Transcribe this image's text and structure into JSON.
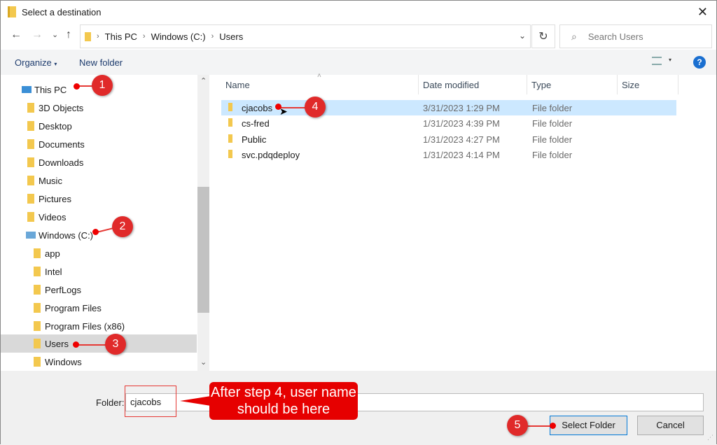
{
  "window": {
    "title": "Select a destination"
  },
  "address": {
    "crumbs": [
      "This PC",
      "Windows (C:)",
      "Users"
    ]
  },
  "search": {
    "placeholder": "Search Users"
  },
  "toolbar": {
    "organize": "Organize",
    "organize_caret": "▾",
    "new_folder": "New folder",
    "help": "?"
  },
  "nav": {
    "items": [
      {
        "label": "This PC",
        "kind": "pc",
        "level": 0
      },
      {
        "label": "3D Objects",
        "kind": "folder",
        "level": 1
      },
      {
        "label": "Desktop",
        "kind": "folder",
        "level": 1
      },
      {
        "label": "Documents",
        "kind": "folder",
        "level": 1
      },
      {
        "label": "Downloads",
        "kind": "folder",
        "level": 1
      },
      {
        "label": "Music",
        "kind": "folder",
        "level": 1
      },
      {
        "label": "Pictures",
        "kind": "folder",
        "level": 1
      },
      {
        "label": "Videos",
        "kind": "folder",
        "level": 1
      },
      {
        "label": "Windows (C:)",
        "kind": "drive",
        "level": 1
      },
      {
        "label": "app",
        "kind": "folder",
        "level": 2
      },
      {
        "label": "Intel",
        "kind": "folder",
        "level": 2
      },
      {
        "label": "PerfLogs",
        "kind": "folder",
        "level": 2
      },
      {
        "label": "Program Files",
        "kind": "folder",
        "level": 2
      },
      {
        "label": "Program Files (x86)",
        "kind": "folder",
        "level": 2
      },
      {
        "label": "Users",
        "kind": "folder",
        "level": 2,
        "selected": true
      },
      {
        "label": "Windows",
        "kind": "folder",
        "level": 2
      }
    ]
  },
  "columns": {
    "name": "Name",
    "date": "Date modified",
    "type": "Type",
    "size": "Size"
  },
  "files": [
    {
      "name": "cjacobs",
      "date": "3/31/2023 1:29 PM",
      "type": "File folder",
      "selected": true
    },
    {
      "name": "cs-fred",
      "date": "1/31/2023 4:39 PM",
      "type": "File folder"
    },
    {
      "name": "Public",
      "date": "1/31/2023 4:27 PM",
      "type": "File folder"
    },
    {
      "name": "svc.pdqdeploy",
      "date": "1/31/2023 4:14 PM",
      "type": "File folder"
    }
  ],
  "footer": {
    "folder_label": "Folder:",
    "folder_value": "cjacobs",
    "select_button": "Select Folder",
    "cancel_button": "Cancel"
  },
  "annotations": {
    "callout": "After step 4, user name should be here",
    "badges": [
      "1",
      "2",
      "3",
      "4",
      "5"
    ]
  }
}
